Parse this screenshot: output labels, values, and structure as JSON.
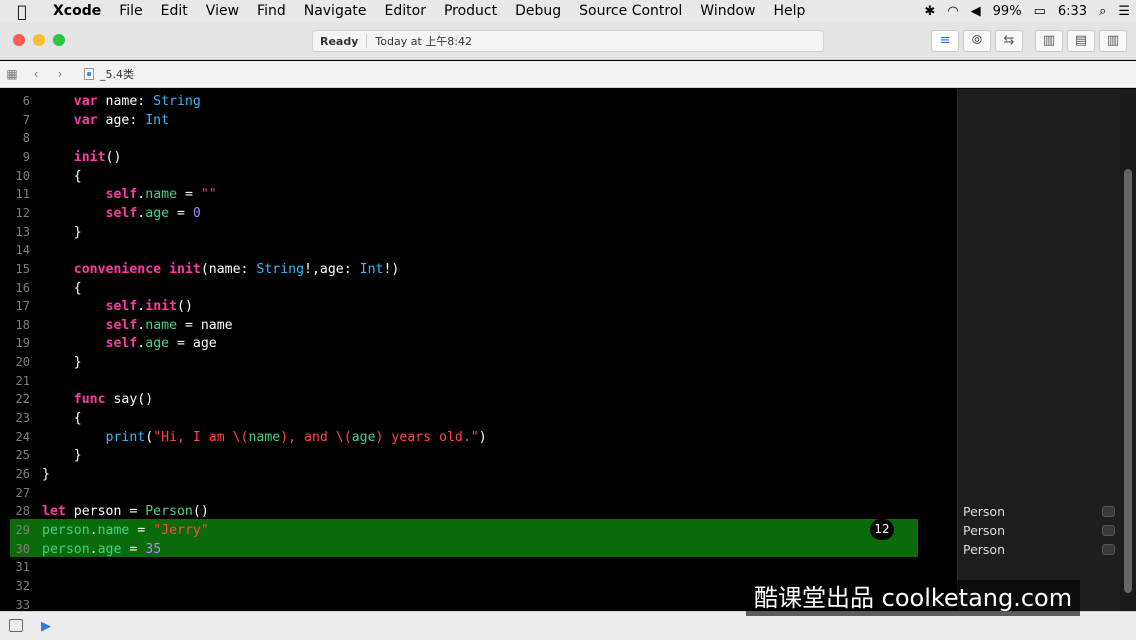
{
  "menubar": {
    "app": "Xcode",
    "items": [
      "File",
      "Edit",
      "View",
      "Find",
      "Navigate",
      "Editor",
      "Product",
      "Debug",
      "Source Control",
      "Window",
      "Help"
    ],
    "battery": "99%",
    "clock": "6:33"
  },
  "toolbar": {
    "status": "Ready",
    "timestamp": "Today at 上午8:42"
  },
  "jumpbar": {
    "file": "_5.4类"
  },
  "editor": {
    "badge": "12",
    "lines": [
      {
        "num": "6",
        "html": "    <span class=\"k\">var</span> name: <span class=\"t\">String</span>"
      },
      {
        "num": "7",
        "html": "    <span class=\"k\">var</span> age: <span class=\"t\">Int</span>"
      },
      {
        "num": "8",
        "html": ""
      },
      {
        "num": "9",
        "html": "    <span class=\"k\">init</span>()"
      },
      {
        "num": "10",
        "html": "    {"
      },
      {
        "num": "11",
        "html": "        <span class=\"k\">self</span>.<span class=\"p\">name</span> = <span class=\"s\">\"\"</span>"
      },
      {
        "num": "12",
        "html": "        <span class=\"k\">self</span>.<span class=\"p\">age</span> = <span class=\"n\">0</span>"
      },
      {
        "num": "13",
        "html": "    }"
      },
      {
        "num": "14",
        "html": ""
      },
      {
        "num": "15",
        "html": "    <span class=\"k\">convenience</span> <span class=\"k\">init</span>(name: <span class=\"t\">String</span>!,age: <span class=\"t\">Int</span>!)"
      },
      {
        "num": "16",
        "html": "    {"
      },
      {
        "num": "17",
        "html": "        <span class=\"k\">self</span>.<span class=\"k\">init</span>()"
      },
      {
        "num": "18",
        "html": "        <span class=\"k\">self</span>.<span class=\"p\">name</span> = name"
      },
      {
        "num": "19",
        "html": "        <span class=\"k\">self</span>.<span class=\"p\">age</span> = age"
      },
      {
        "num": "20",
        "html": "    }"
      },
      {
        "num": "21",
        "html": ""
      },
      {
        "num": "22",
        "html": "    <span class=\"k\">func</span> say()"
      },
      {
        "num": "23",
        "html": "    {"
      },
      {
        "num": "24",
        "html": "        <span class=\"t\">print</span>(<span class=\"s\">\"Hi, I am \\(</span><span class=\"p\">name</span><span class=\"s\">), and \\(</span><span class=\"p\">age</span><span class=\"s\">) years old.\"</span>)"
      },
      {
        "num": "25",
        "html": "    }"
      },
      {
        "num": "26",
        "html": "}"
      },
      {
        "num": "27",
        "html": ""
      },
      {
        "num": "28",
        "html": "<span class=\"k\">let</span> person = <span class=\"p\">Person</span>()"
      },
      {
        "num": "29",
        "html": "<span class=\"p\">person</span>.<span class=\"p\">name</span> = <span class=\"s\">\"Jerry\"</span>"
      },
      {
        "num": "30",
        "html": "<span class=\"p\">person</span>.<span class=\"p\">age</span> = <span class=\"n\">35</span>"
      },
      {
        "num": "31",
        "html": ""
      },
      {
        "num": "32",
        "html": ""
      },
      {
        "num": "33",
        "html": ""
      }
    ]
  },
  "results": [
    {
      "line": 28,
      "text": "Person"
    },
    {
      "line": 29,
      "text": "Person"
    },
    {
      "line": 30,
      "text": "Person"
    }
  ],
  "watermark": "酷课堂出品 coolketang.com"
}
